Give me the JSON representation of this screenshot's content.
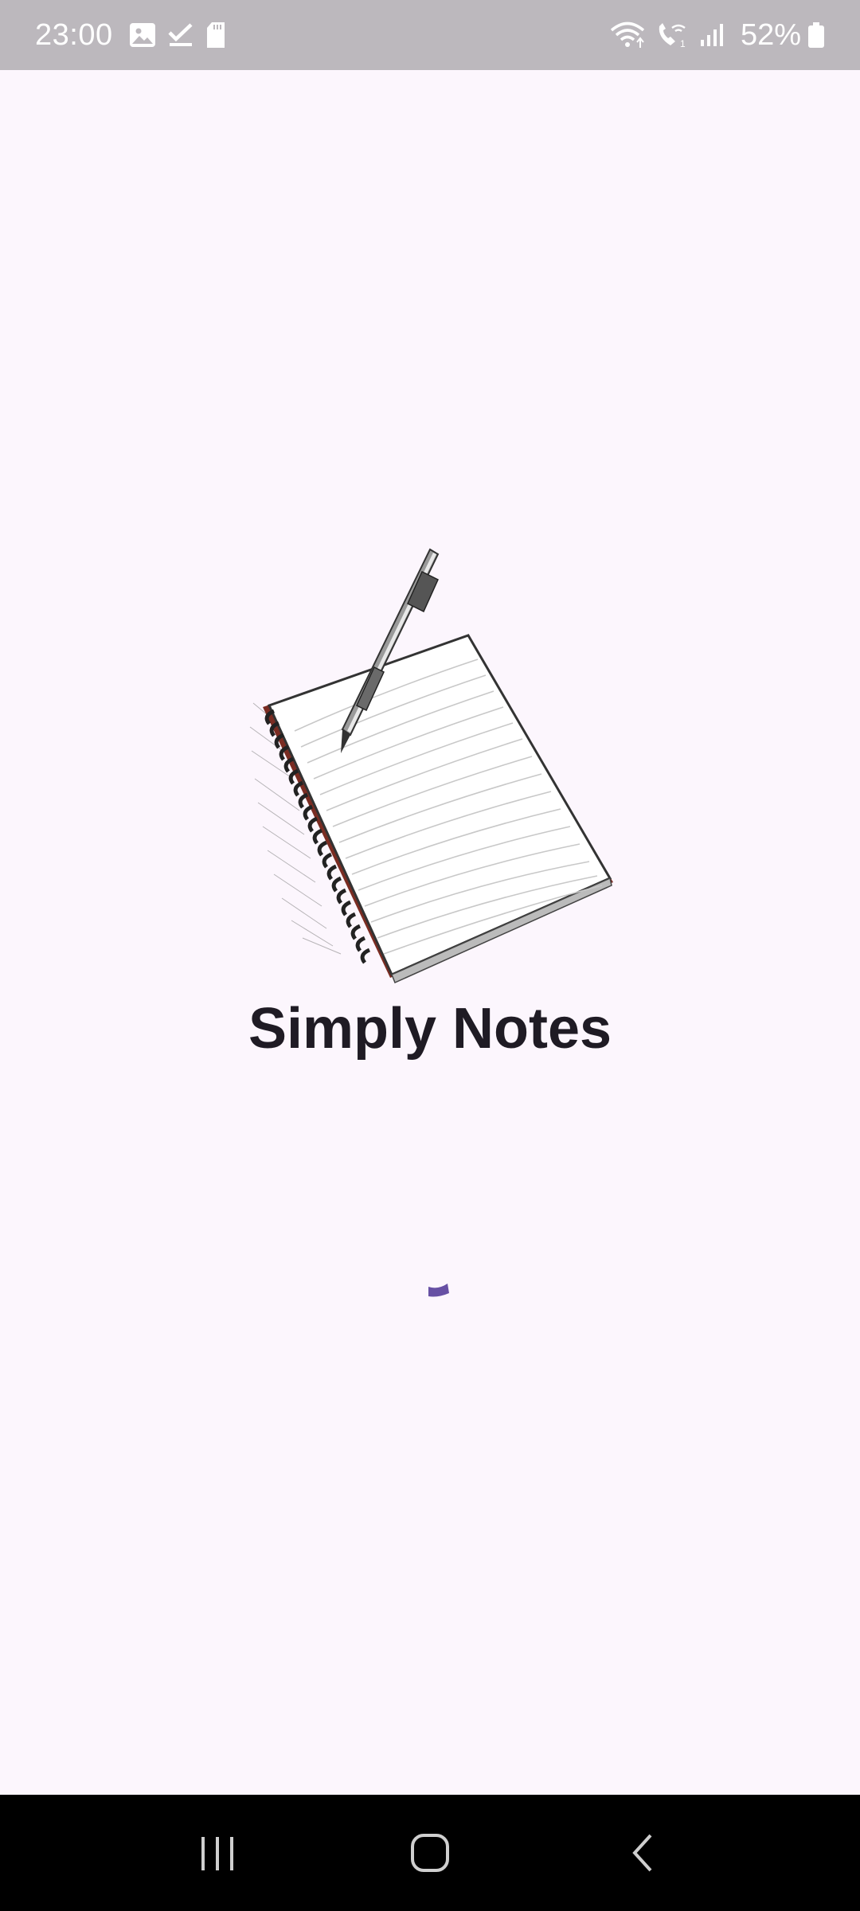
{
  "status_bar": {
    "time": "23:00",
    "battery_percent": "52%",
    "icons_left": [
      "gallery-icon",
      "check-icon",
      "sd-card-icon"
    ],
    "icons_right": [
      "wifi-icon",
      "wifi-calling-icon",
      "signal-icon",
      "battery-icon"
    ]
  },
  "splash": {
    "app_name": "Simply Notes",
    "logo": "notebook-with-pen-icon",
    "accent_color": "#6750a4"
  },
  "nav_bar": {
    "buttons": [
      "recent-apps",
      "home",
      "back"
    ]
  }
}
